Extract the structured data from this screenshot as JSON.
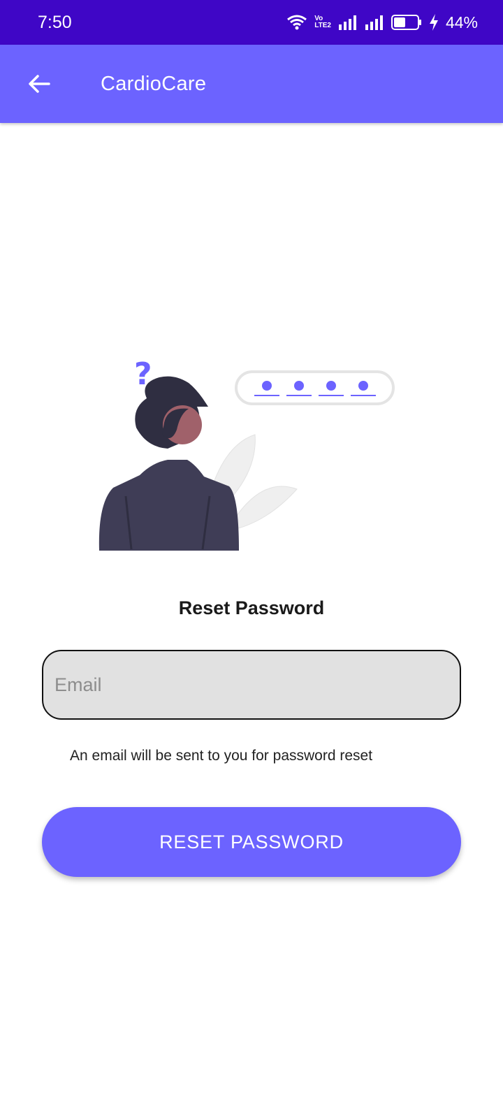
{
  "status_bar": {
    "time": "7:50",
    "volte_top": "Vo",
    "volte_bottom": "LTE2",
    "battery": "44%",
    "icons": [
      "wifi-icon",
      "volte-icon",
      "signal-icon",
      "signal-icon",
      "battery-icon",
      "charging-icon"
    ]
  },
  "app_bar": {
    "back_icon": "arrow-back-icon",
    "title": "CardioCare"
  },
  "illustration": {
    "question_mark": "?",
    "accent_color": "#6c63ff"
  },
  "reset": {
    "heading": "Reset Password",
    "email_placeholder": "Email",
    "email_value": "",
    "hint": "An email will be sent to you for password reset",
    "button_label": "RESET PASSWORD"
  },
  "colors": {
    "status_bar": "#3f06c6",
    "primary": "#6c63ff",
    "field_background": "#e1e1e1"
  }
}
